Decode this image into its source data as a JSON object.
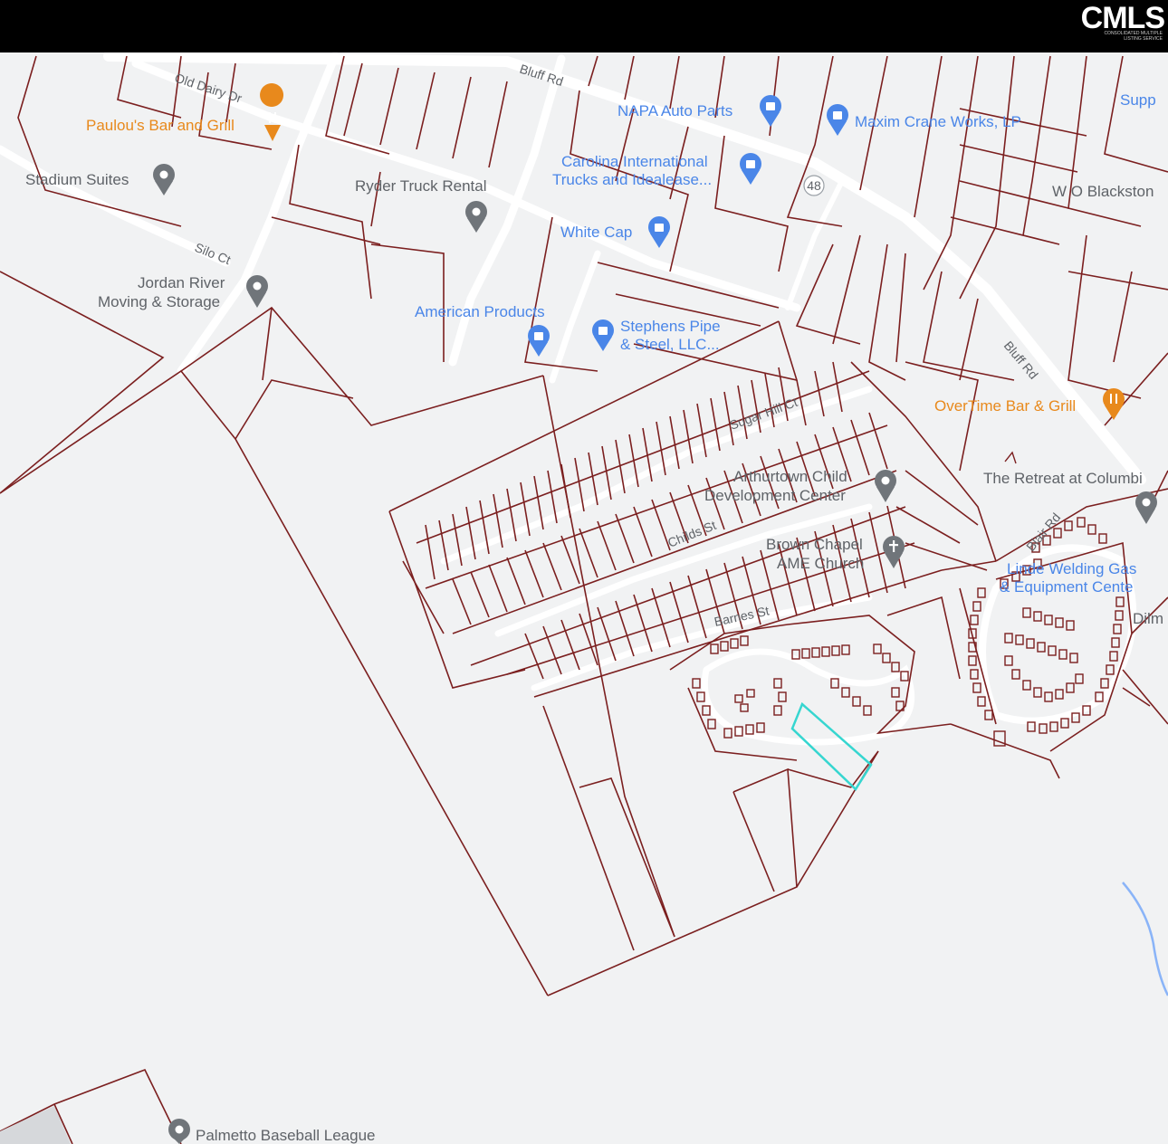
{
  "header": {
    "logo_text": "CMLS",
    "logo_subtext": "CONSOLIDATED MULTIPLE LISTING SERVICE"
  },
  "colors": {
    "background": "#f1f2f3",
    "road": "#ffffff",
    "parcel": "#7b1f1f",
    "highlight": "#36d6d0",
    "poi_blue": "#4a86e8",
    "poi_gray": "#70757a",
    "poi_orange": "#e8891c",
    "stream": "#8ab4f8"
  },
  "road_labels": {
    "bluff_rd_1": "Bluff Rd",
    "bluff_rd_2": "Bluff Rd",
    "old_dairy_dr": "Old Dairy Dr",
    "silo_ct": "Silo Ct",
    "sugar_hill_ct": "Sugar Hill Ct",
    "childs_st": "Childs St",
    "barnes_st": "Barnes St",
    "blair_rd": "Blair Rd",
    "route_shield": "48"
  },
  "pois": [
    {
      "label": "Paulou's Bar and Grill",
      "icon": "restaurant-icon",
      "color": "orange"
    },
    {
      "label": "Stadium Suites",
      "icon": "place-pin-icon",
      "color": "gray"
    },
    {
      "label": "Ryder Truck Rental",
      "icon": "place-pin-icon",
      "color": "gray"
    },
    {
      "label": "NAPA Auto Parts",
      "icon": "shopping-bag-icon",
      "color": "blue"
    },
    {
      "label": "Maxim Crane Works, LP",
      "icon": "shopping-bag-icon",
      "color": "blue"
    },
    {
      "label": "Carolina International",
      "label2": "Trucks and Idealease...",
      "icon": "shopping-bag-icon",
      "color": "blue"
    },
    {
      "label": "White Cap",
      "icon": "shopping-bag-icon",
      "color": "blue"
    },
    {
      "label": "Jordan River",
      "label2": "Moving & Storage",
      "icon": "place-pin-icon",
      "color": "gray"
    },
    {
      "label": "American Products",
      "icon": "shopping-bag-icon",
      "color": "blue"
    },
    {
      "label": "Stephens Pipe",
      "label2": "& Steel, LLC...",
      "icon": "shopping-bag-icon",
      "color": "blue"
    },
    {
      "label": "W O Blackston",
      "icon": "none",
      "color": "gray"
    },
    {
      "label": "Supp",
      "icon": "none",
      "color": "blue"
    },
    {
      "label": "OverTime Bar & Grill",
      "icon": "restaurant-icon",
      "color": "orange"
    },
    {
      "label": "Arthurtown Child",
      "label2": "Development Center",
      "icon": "place-pin-icon",
      "color": "gray"
    },
    {
      "label": "The Retreat at Columbi",
      "icon": "place-pin-icon",
      "color": "gray"
    },
    {
      "label": "Brown Chapel",
      "label2": "AME Church",
      "icon": "church-pin-icon",
      "color": "gray"
    },
    {
      "label": "Linde Welding Gas",
      "label2": "& Equipment Cente",
      "icon": "none",
      "color": "blue"
    },
    {
      "label": "Dilm",
      "icon": "none",
      "color": "gray"
    },
    {
      "label": "Palmetto Baseball League",
      "icon": "place-pin-icon",
      "color": "gray"
    }
  ]
}
